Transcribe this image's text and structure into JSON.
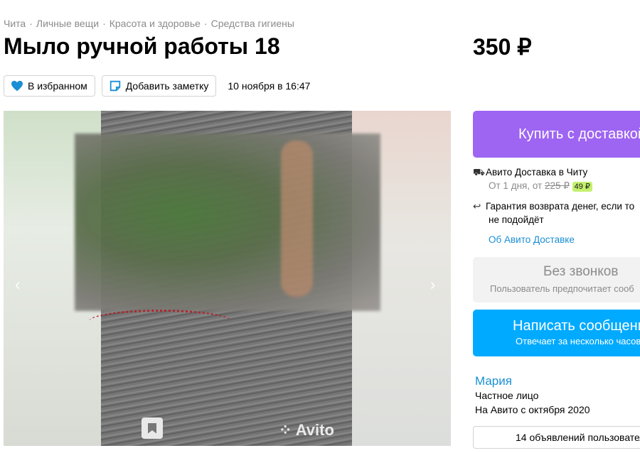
{
  "breadcrumbs": [
    "Чита",
    "Личные вещи",
    "Красота и здоровье",
    "Средства гигиены"
  ],
  "breadcrumb_separator": "·",
  "title": "Мыло ручной работы 18",
  "price": "350 ₽",
  "favorite_button": {
    "label": "В избранном",
    "icon": "heart-icon"
  },
  "note_button": {
    "label": "Добавить заметку",
    "icon": "note-icon"
  },
  "posted_date": "10 ноября в 16:47",
  "gallery": {
    "prev_icon": "‹",
    "next_icon": "›",
    "watermark": "Avito"
  },
  "buy_button": {
    "label": "Купить с доставкой"
  },
  "delivery": {
    "title": "Авито Доставка в Читу",
    "time": "От 1 дня, от",
    "old_price": "225 ₽",
    "new_price": "49 ₽"
  },
  "guarantee": {
    "line1": "Гарантия возврата денег, если то",
    "line2": "не подойдёт"
  },
  "about_delivery_link": "Об Авито Доставке",
  "no_calls": {
    "title": "Без звонков",
    "subtitle": "Пользователь предпочитает сооб"
  },
  "write_button": {
    "title": "Написать сообщение",
    "subtitle": "Отвечает за несколько часов"
  },
  "seller": {
    "name": "Мария",
    "type": "Частное лицо",
    "since": "На Авито с октября 2020"
  },
  "ads_button": {
    "label": "14 объявлений пользовател"
  },
  "colors": {
    "buy": "#9e64f2",
    "write": "#00aaff",
    "link": "#1a8fd6",
    "badge": "#c3f06d"
  }
}
